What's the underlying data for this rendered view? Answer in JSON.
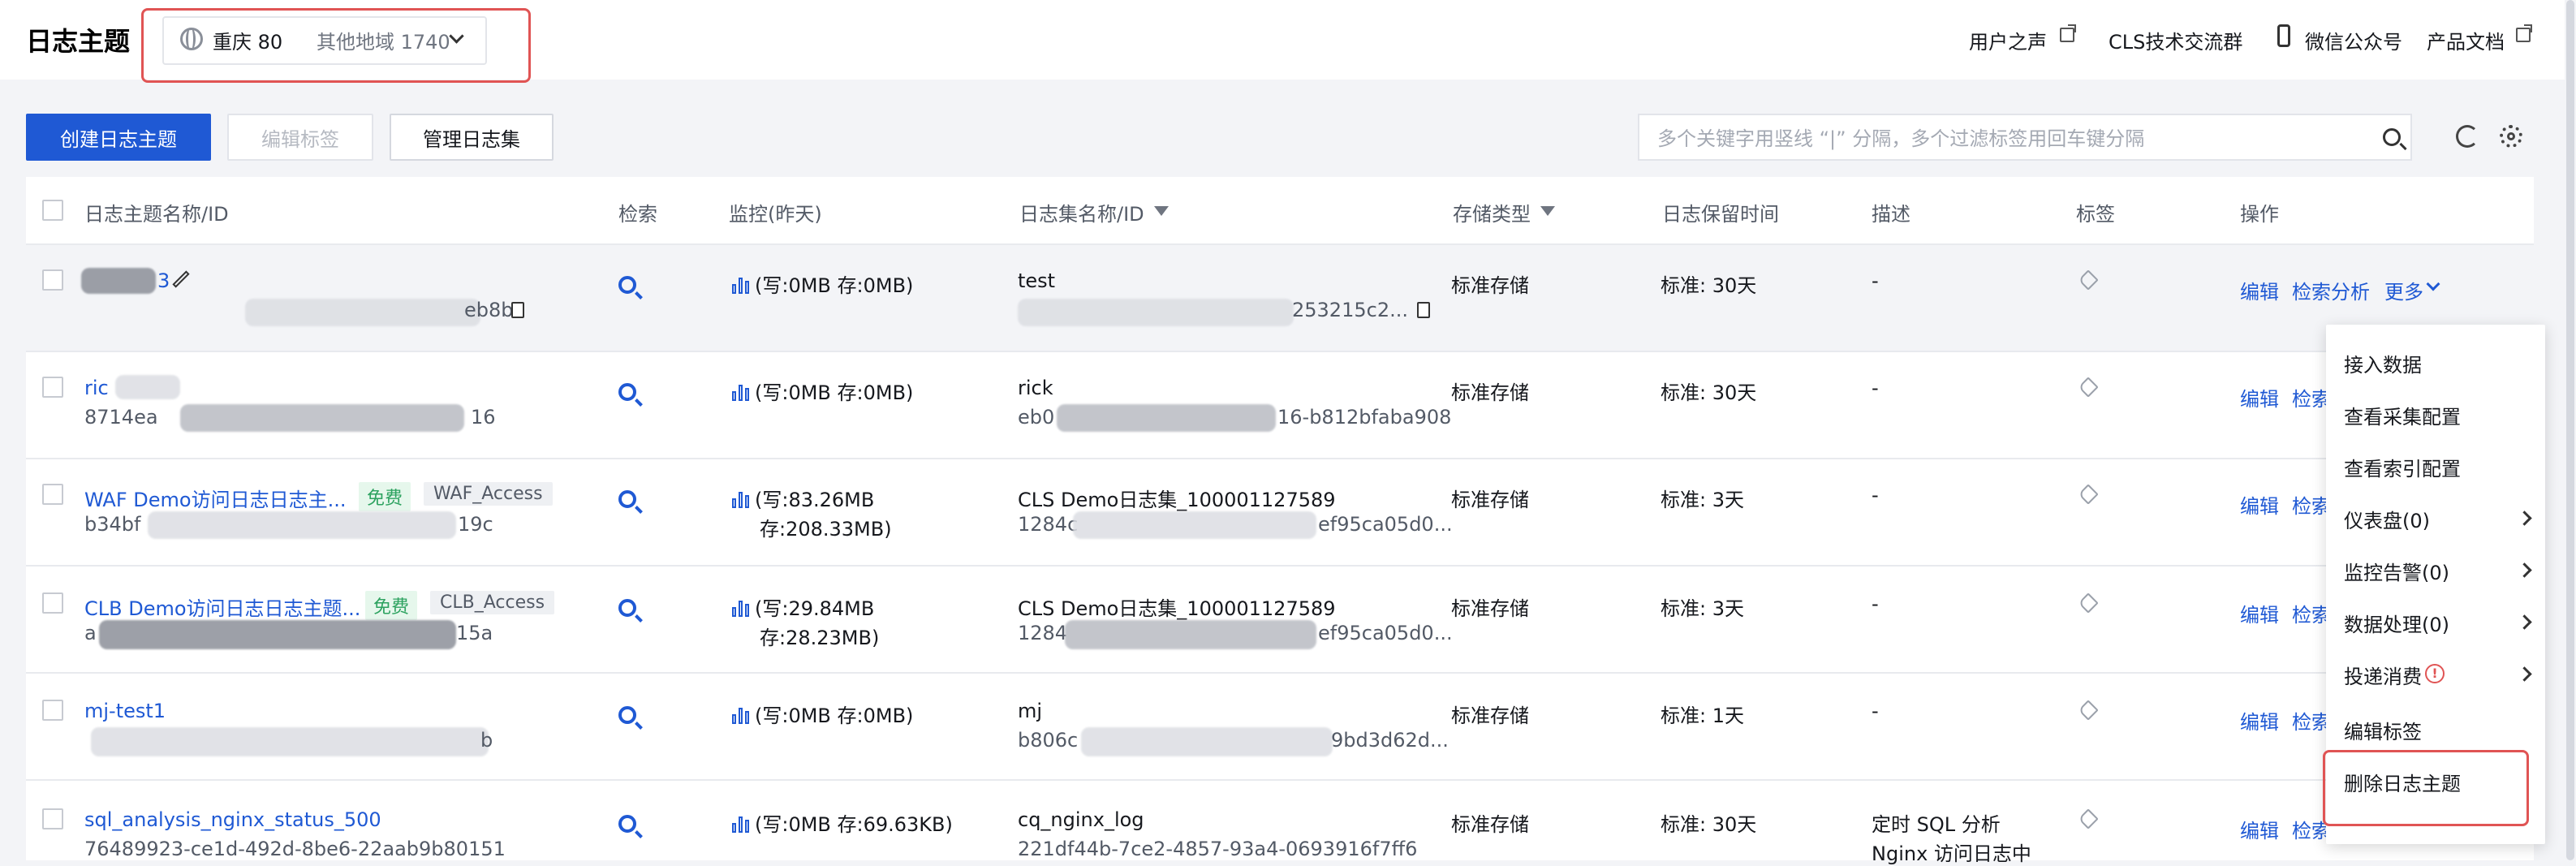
{
  "header": {
    "title": "日志主题",
    "region_current": "重庆 80",
    "region_other": "其他地域 1740",
    "links": [
      "用户之声",
      "CLS技术交流群",
      "微信公众号",
      "产品文档"
    ]
  },
  "toolbar": {
    "create_label": "创建日志主题",
    "edit_tags_label": "编辑标签",
    "manage_logsets_label": "管理日志集",
    "search_placeholder": "多个关键字用竖线 “|” 分隔，多个过滤标签用回车键分隔"
  },
  "table": {
    "columns": [
      "日志主题名称/ID",
      "检索",
      "监控(昨天)",
      "日志集名称/ID",
      "存储类型",
      "日志保留时间",
      "描述",
      "标签",
      "操作"
    ],
    "rows": [
      {
        "name": "3",
        "id_tail": "eb8b",
        "monitor1": "(写:0MB  存:0MB)",
        "monitor2": "",
        "logset": "test",
        "logset_id": "253215c2...",
        "storage": "标准存储",
        "retention": "标准: 30天",
        "desc": "-",
        "desc2": ""
      },
      {
        "name": "ric",
        "id_head": "8714ea",
        "id_tail": "16",
        "monitor1": "(写:0MB  存:0MB)",
        "monitor2": "",
        "logset": "rick",
        "logset_id_head": "eb0",
        "logset_id": "16-b812bfaba908",
        "storage": "标准存储",
        "retention": "标准: 30天",
        "desc": "-",
        "desc2": ""
      },
      {
        "name": "WAF Demo访问日志日志主...",
        "free": "免费",
        "tag": "WAF_Access",
        "id_head": "b34bf",
        "id_tail": "19c",
        "monitor1": "(写:83.26MB",
        "monitor2": "存:208.33MB)",
        "logset": "CLS Demo日志集_100001127589",
        "logset_id_head": "1284c",
        "logset_id": "ef95ca05d0...",
        "storage": "标准存储",
        "retention": "标准: 3天",
        "desc": "-",
        "desc2": ""
      },
      {
        "name": "CLB Demo访问日志日志主题...",
        "free": "免费",
        "tag": "CLB_Access",
        "id_head": "a",
        "id_tail": "15a",
        "monitor1": "(写:29.84MB",
        "monitor2": "存:28.23MB)",
        "logset": "CLS Demo日志集_100001127589",
        "logset_id_head": "1284",
        "logset_id": "ef95ca05d0...",
        "storage": "标准存储",
        "retention": "标准: 3天",
        "desc": "-",
        "desc2": ""
      },
      {
        "name": "mj-test1",
        "id_tail": "b",
        "monitor1": "(写:0MB  存:0MB)",
        "monitor2": "",
        "logset": "mj",
        "logset_id_head": "b806c",
        "logset_id": "9bd3d62d...",
        "storage": "标准存储",
        "retention": "标准: 1天",
        "desc": "-",
        "desc2": ""
      },
      {
        "name": "sql_analysis_nginx_status_500",
        "id": "76489923-ce1d-492d-8be6-22aab9b80151",
        "monitor1": "(写:0MB  存:69.63KB)",
        "monitor2": "",
        "logset": "cq_nginx_log",
        "logset_id": "221df44b-7ce2-4857-93a4-0693916f7ff6",
        "storage": "标准存储",
        "retention": "标准: 30天",
        "desc": "定时 SQL 分析",
        "desc2": "Nginx 访问日志中"
      }
    ],
    "actions": {
      "edit": "编辑",
      "analyze": "检索分析",
      "more": "更多",
      "analyze_short": "检索"
    }
  },
  "more_menu": {
    "items": [
      "接入数据",
      "查看采集配置",
      "查看索引配置",
      "仪表盘(0)",
      "监控告警(0)",
      "数据处理(0)",
      "投递消费",
      "编辑标签",
      "删除日志主题"
    ]
  },
  "colors": {
    "accent": "#1f59d4",
    "highlight": "#e05454",
    "free_tag": "#2ca25f"
  }
}
